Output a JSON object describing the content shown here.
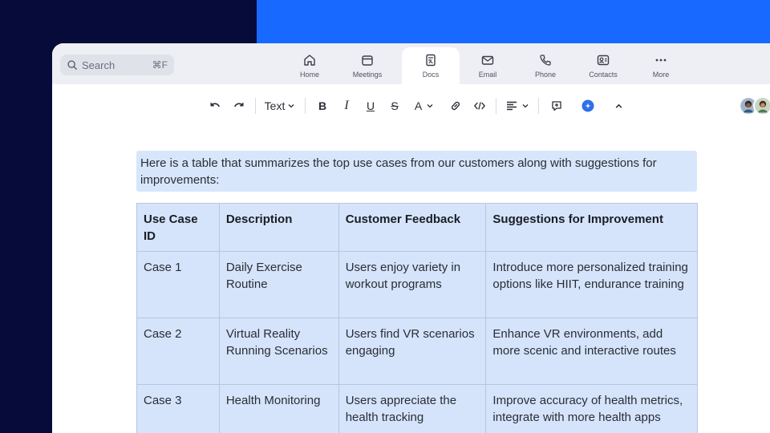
{
  "nav": {
    "search": {
      "placeholder": "Search",
      "shortcut": "⌘F"
    },
    "tabs": [
      {
        "label": "Home",
        "icon": "home-icon"
      },
      {
        "label": "Meetings",
        "icon": "meetings-icon"
      },
      {
        "label": "Docs",
        "icon": "docs-icon",
        "active": true
      },
      {
        "label": "Email",
        "icon": "email-icon"
      },
      {
        "label": "Phone",
        "icon": "phone-icon"
      },
      {
        "label": "Contacts",
        "icon": "contacts-icon"
      },
      {
        "label": "More",
        "icon": "more-icon"
      }
    ]
  },
  "toolbar": {
    "text_style": "Text",
    "bold": "B",
    "italic": "I",
    "underline": "U",
    "strikethrough": "S",
    "font_color": "A"
  },
  "document": {
    "intro": "Here is a table that summarizes the top use cases from our customers along with suggestions for improvements:",
    "table": {
      "headers": [
        "Use Case ID",
        "Description",
        "Customer Feedback",
        "Suggestions for Improvement"
      ],
      "rows": [
        [
          "Case 1",
          "Daily Exercise Routine",
          "Users enjoy variety in workout programs",
          "Introduce more personalized training options like HIIT, endurance training"
        ],
        [
          "Case 2",
          "Virtual Reality Running Scenarios",
          "Users find VR scenarios engaging",
          "Enhance VR environments, add more scenic and interactive routes"
        ],
        [
          "Case 3",
          "Health Monitoring",
          "Users appreciate the health tracking",
          "Improve accuracy of health metrics, integrate with more health apps"
        ]
      ]
    }
  },
  "colors": {
    "left_background": "#060b3a",
    "right_background": "#1769ff",
    "highlight": "#d5e4fb",
    "accent": "#2f6fe8"
  }
}
